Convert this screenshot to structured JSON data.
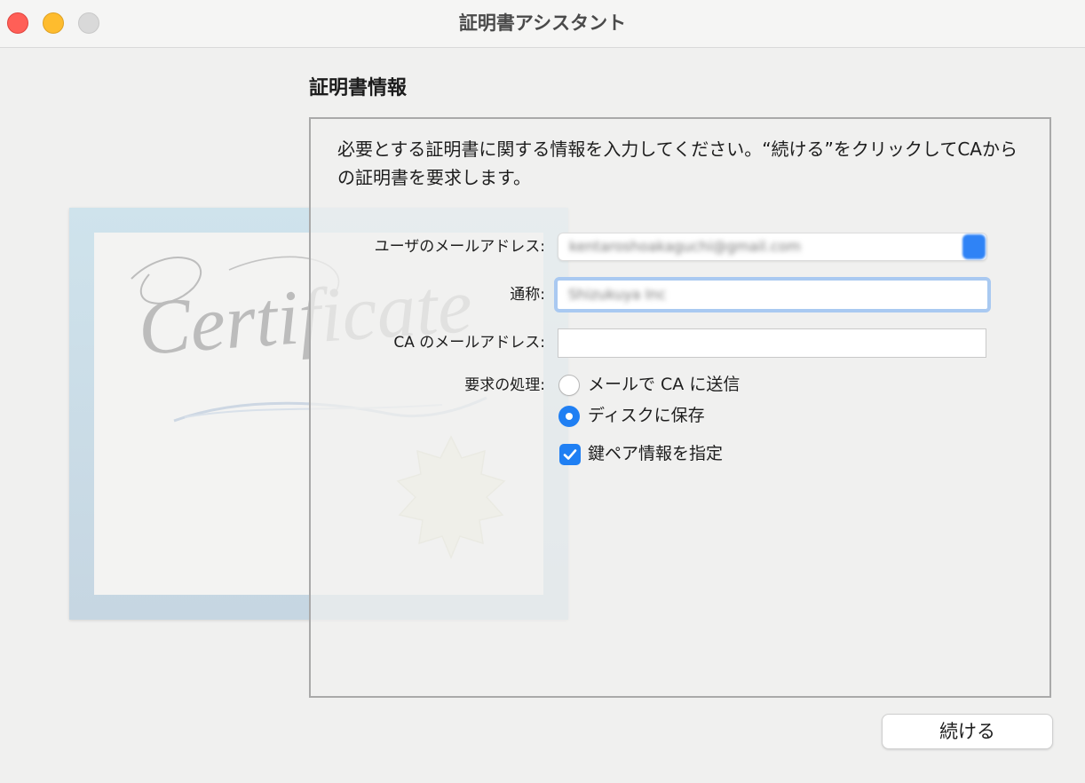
{
  "window": {
    "title": "証明書アシスタント"
  },
  "section": {
    "title": "証明書情報"
  },
  "intro": {
    "text": "必要とする証明書に関する情報を入力してください。“続ける”をクリックしてCAからの証明書を要求します。"
  },
  "form": {
    "user_email": {
      "label": "ユーザのメールアドレス:",
      "value": "kentaroshoakaguchi@gmail.com"
    },
    "common_name": {
      "label": "通称:",
      "value": "Shizukuya Inc"
    },
    "ca_email": {
      "label": "CA のメールアドレス:",
      "value": ""
    },
    "request": {
      "label": "要求の処理:",
      "options": [
        {
          "label": "メールで CA に送信",
          "selected": false
        },
        {
          "label": "ディスクに保存",
          "selected": true
        }
      ]
    },
    "key_pair": {
      "label": "鍵ペア情報を指定",
      "checked": true
    }
  },
  "buttons": {
    "continue": "続ける"
  },
  "artwork": {
    "word": "Certificate"
  },
  "colors": {
    "accent": "#1f7ff3",
    "close": "#ff5f57",
    "minimize": "#febc2e",
    "zoom": "#d9d9d9"
  },
  "icons": {
    "checkbox": "checkmark-icon"
  }
}
